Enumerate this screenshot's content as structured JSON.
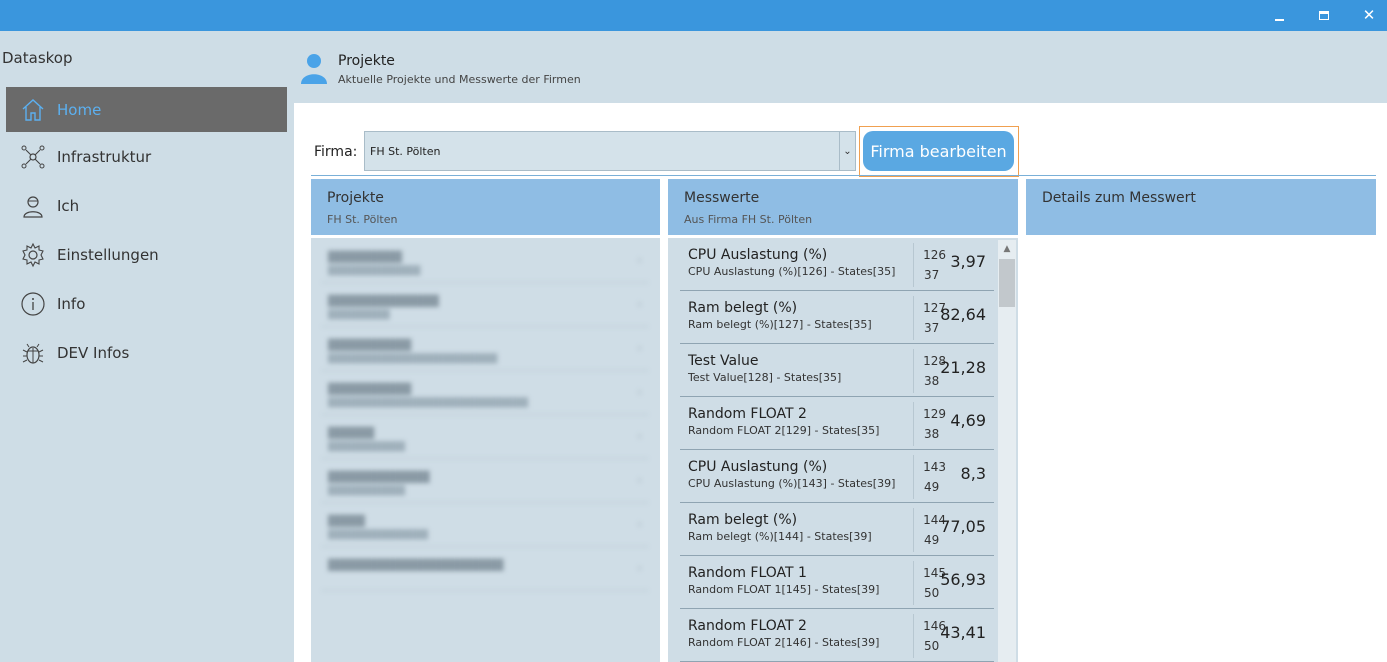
{
  "app": {
    "title": "Dataskop"
  },
  "window": {
    "minimize": "",
    "maximize": "",
    "close": "✕"
  },
  "sidebar": {
    "items": [
      {
        "label": "Home",
        "icon": "home-icon",
        "active": true
      },
      {
        "label": "Infrastruktur",
        "icon": "network-icon"
      },
      {
        "label": "Ich",
        "icon": "user-outline-icon"
      },
      {
        "label": "Einstellungen",
        "icon": "gear-icon"
      },
      {
        "label": "Info",
        "icon": "info-icon"
      },
      {
        "label": "DEV Infos",
        "icon": "bug-icon"
      }
    ]
  },
  "header": {
    "title": "Projekte",
    "subtitle": "Aktuelle Projekte und Messwerte der Firmen"
  },
  "firma": {
    "label": "Firma:",
    "selected": "FH St. Pölten",
    "edit_button": "Firma bearbeiten"
  },
  "panels": {
    "projekte": {
      "title": "Projekte",
      "subtitle": "FH St. Pölten"
    },
    "messwerte": {
      "title": "Messwerte",
      "subtitle": "Aus Firma FH St. Pölten"
    },
    "details": {
      "title": "Details zum Messwert"
    }
  },
  "messwerte": [
    {
      "name": "CPU Auslastung (%)",
      "desc": "CPU Auslastung (%)[126] - States[35]",
      "id": "126",
      "state": "37",
      "value": "3,97"
    },
    {
      "name": "Ram belegt (%)",
      "desc": "Ram belegt (%)[127] - States[35]",
      "id": "127",
      "state": "37",
      "value": "82,64"
    },
    {
      "name": "Test Value",
      "desc": "Test Value[128] - States[35]",
      "id": "128",
      "state": "38",
      "value": "21,28"
    },
    {
      "name": "Random FLOAT 2",
      "desc": "Random FLOAT 2[129] - States[35]",
      "id": "129",
      "state": "38",
      "value": "4,69"
    },
    {
      "name": "CPU Auslastung (%)",
      "desc": "CPU Auslastung (%)[143] - States[39]",
      "id": "143",
      "state": "49",
      "value": "8,3"
    },
    {
      "name": "Ram belegt (%)",
      "desc": "Ram belegt (%)[144] - States[39]",
      "id": "144",
      "state": "49",
      "value": "77,05"
    },
    {
      "name": "Random FLOAT 1",
      "desc": "Random FLOAT 1[145] - States[39]",
      "id": "145",
      "state": "50",
      "value": "56,93"
    },
    {
      "name": "Random FLOAT 2",
      "desc": "Random FLOAT 2[146] - States[39]",
      "id": "146",
      "state": "50",
      "value": "43,41"
    }
  ],
  "colors": {
    "titlebar": "#3a96dd",
    "sidebar": "#ceddE6",
    "accent": "#5aa8e2",
    "panel_header": "#8fbde4",
    "highlight": "#f0a050"
  }
}
